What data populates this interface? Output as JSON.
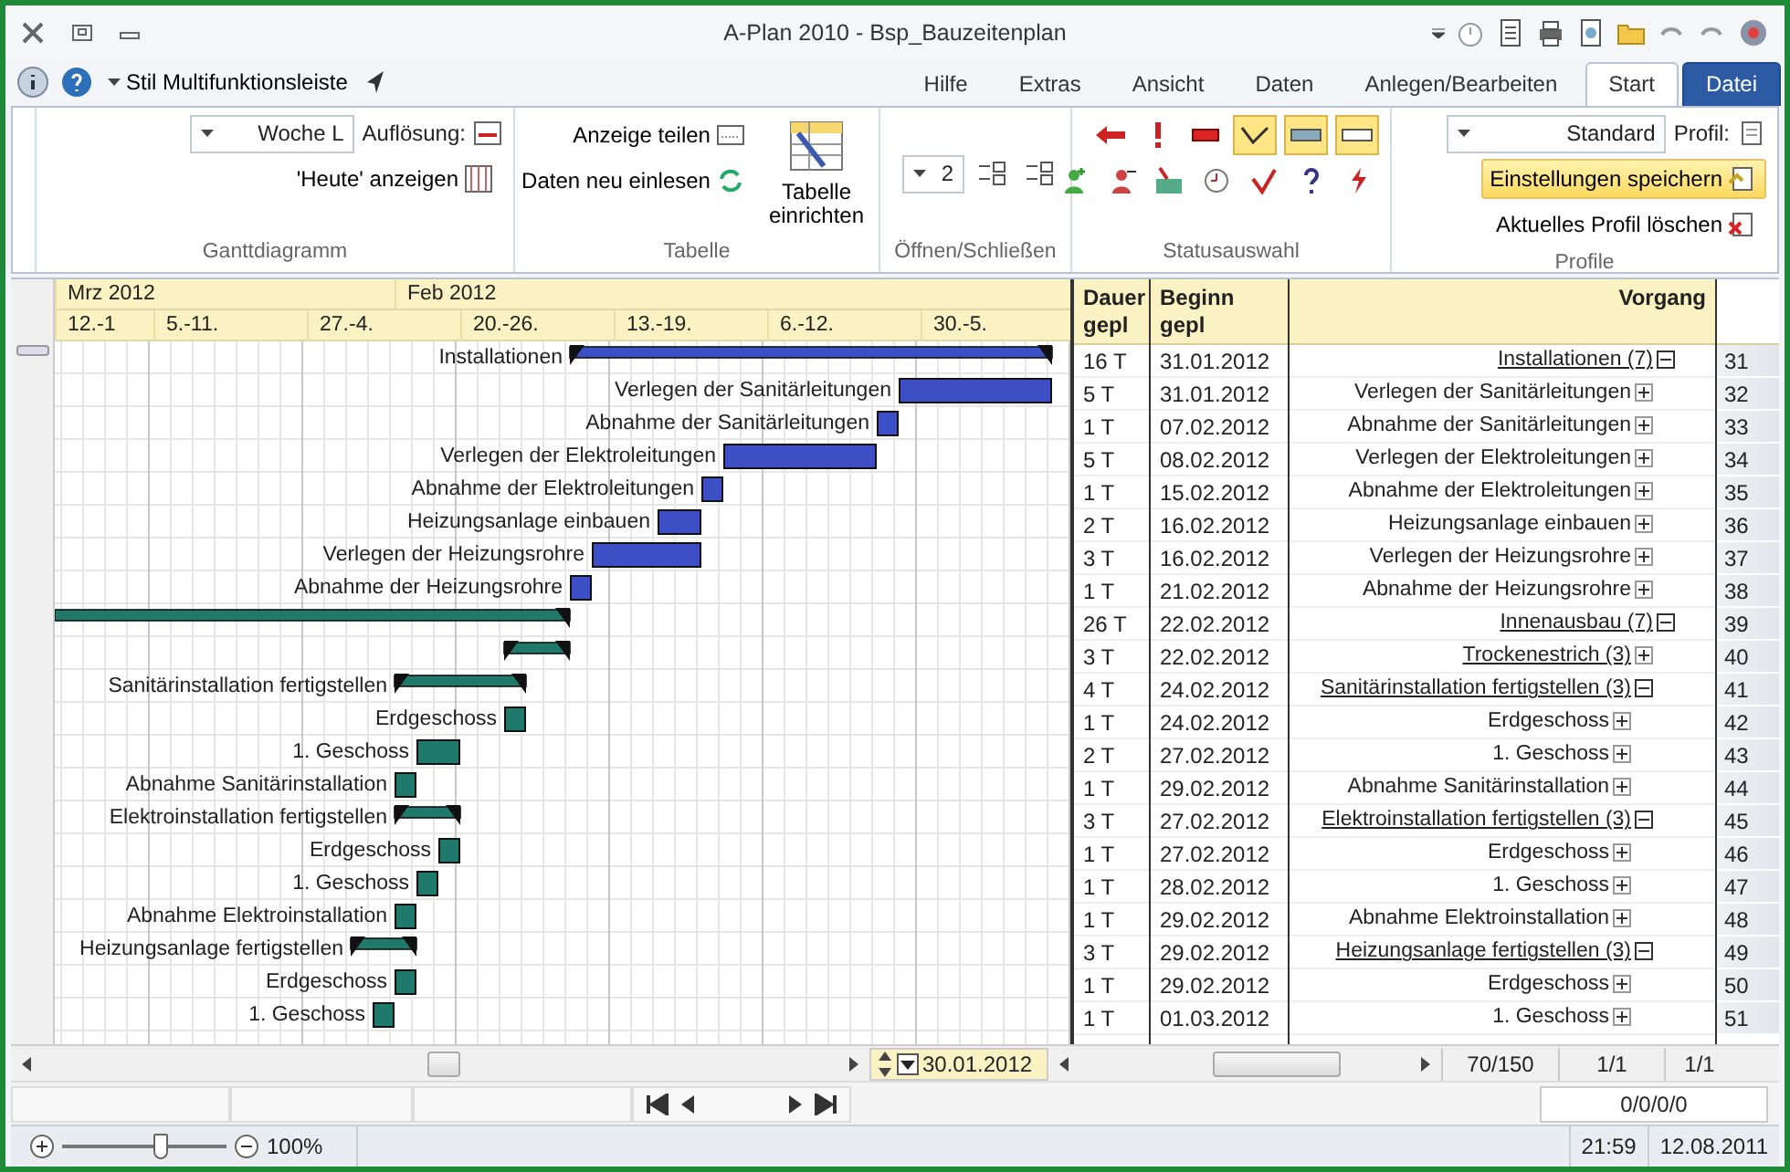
{
  "window": {
    "title": "A-Plan 2010 - Bsp_Bauzeitenplan"
  },
  "ribbon_tabs": [
    {
      "label": "Hilfe",
      "kind": "tab",
      "selected": false
    },
    {
      "label": "Extras",
      "kind": "tab",
      "selected": false
    },
    {
      "label": "Ansicht",
      "kind": "tab",
      "selected": false
    },
    {
      "label": "Daten",
      "kind": "tab",
      "selected": false
    },
    {
      "label": "Anlegen/Bearbeiten",
      "kind": "tab",
      "selected": false
    },
    {
      "label": "Start",
      "kind": "tab",
      "selected": true
    },
    {
      "label": "Datei",
      "kind": "file",
      "selected": false
    }
  ],
  "style_menu": {
    "label": "Stil Multifunktionsleiste"
  },
  "ribbon": {
    "profile": {
      "group": "Profile",
      "label": "Profil:",
      "value": "Standard",
      "buttons": [
        {
          "label": "Einstellungen speichern",
          "highlighted": true
        },
        {
          "label": "Aktuelles Profil löschen",
          "highlighted": false
        }
      ]
    },
    "status": {
      "group": "Statusauswahl",
      "toggles": [
        {
          "pressed": true
        },
        {
          "pressed": true
        },
        {
          "pressed": true
        }
      ]
    },
    "open_close": {
      "group": "Öffnen/Schließen",
      "value": "2"
    },
    "table": {
      "group": "Tabelle",
      "big_button": "Tabelle einrichten",
      "buttons": [
        "Anzeige teilen",
        "Daten neu einlesen"
      ]
    },
    "gantt": {
      "group": "Ganttdiagramm",
      "resolution_label": "Auflösung:",
      "resolution": "Woche L",
      "today_button": "'Heute' anzeigen"
    }
  },
  "timeline": {
    "months": [
      "Mrz 2012",
      "Feb 2012"
    ],
    "weeks": [
      "12.-1",
      "5.-11.",
      "27.-4.",
      "20.-26.",
      "13.-19.",
      "6.-12.",
      "30.-5."
    ]
  },
  "table": {
    "columns": [
      "Dauer gepl",
      "Beginn gepl",
      "Vorgang"
    ],
    "rows": [
      {
        "nr": "31",
        "name": "Installationen (7)",
        "begin": "31.01.2012",
        "duration": "16 T",
        "expanded": true,
        "color": "#3c4fc4",
        "bar_label": "Installationen",
        "children": [
          {
            "nr": "32",
            "name": "Verlegen der Sanitärleitungen",
            "begin": "31.01.2012",
            "duration": "5 T",
            "expanded": false,
            "color": "#3c4fc4",
            "bar_label": "Verlegen der Sanitärleitungen"
          },
          {
            "nr": "33",
            "name": "Abnahme der Sanitärleitungen",
            "begin": "07.02.2012",
            "duration": "1 T",
            "expanded": false,
            "color": "#3c4fc4",
            "bar_label": "Abnahme der Sanitärleitungen"
          },
          {
            "nr": "34",
            "name": "Verlegen der Elektroleitungen",
            "begin": "08.02.2012",
            "duration": "5 T",
            "expanded": false,
            "color": "#3c4fc4",
            "bar_label": "Verlegen der Elektroleitungen"
          },
          {
            "nr": "35",
            "name": "Abnahme der Elektroleitungen",
            "begin": "15.02.2012",
            "duration": "1 T",
            "expanded": false,
            "color": "#3c4fc4",
            "bar_label": "Abnahme der Elektroleitungen"
          },
          {
            "nr": "36",
            "name": "Heizungsanlage einbauen",
            "begin": "16.02.2012",
            "duration": "2 T",
            "expanded": false,
            "color": "#3c4fc4",
            "bar_label": "Heizungsanlage einbauen"
          },
          {
            "nr": "37",
            "name": "Verlegen der Heizungsrohre",
            "begin": "16.02.2012",
            "duration": "3 T",
            "expanded": false,
            "color": "#3c4fc4",
            "bar_label": "Verlegen der Heizungsrohre"
          },
          {
            "nr": "38",
            "name": "Abnahme der Heizungsrohre",
            "begin": "21.02.2012",
            "duration": "1 T",
            "expanded": false,
            "color": "#3c4fc4",
            "bar_label": "Abnahme der Heizungsrohre"
          }
        ]
      },
      {
        "nr": "39",
        "name": "Innenausbau (7)",
        "begin": "22.02.2012",
        "duration": "26 T",
        "expanded": true,
        "color": "#1f7a6c",
        "children": [
          {
            "nr": "40",
            "name": "Trockenestrich (3)",
            "begin": "22.02.2012",
            "duration": "3 T",
            "expanded": false,
            "summary": true,
            "color": "#1f7a6c"
          },
          {
            "nr": "41",
            "name": "Sanitärinstallation fertigstellen (3)",
            "begin": "24.02.2012",
            "duration": "4 T",
            "expanded": true,
            "color": "#1f7a6c",
            "bar_label": "Sanitärinstallation fertigstellen",
            "children": [
              {
                "nr": "42",
                "name": "Erdgeschoss",
                "begin": "24.02.2012",
                "duration": "1 T",
                "expanded": false,
                "color": "#1f7a6c",
                "bar_label": "Erdgeschoss"
              },
              {
                "nr": "43",
                "name": "1. Geschoss",
                "begin": "27.02.2012",
                "duration": "2 T",
                "expanded": false,
                "color": "#1f7a6c",
                "bar_label": "1. Geschoss"
              },
              {
                "nr": "44",
                "name": "Abnahme Sanitärinstallation",
                "begin": "29.02.2012",
                "duration": "1 T",
                "expanded": false,
                "color": "#1f7a6c",
                "bar_label": "Abnahme Sanitärinstallation"
              }
            ]
          },
          {
            "nr": "45",
            "name": "Elektroinstallation fertigstellen (3)",
            "begin": "27.02.2012",
            "duration": "3 T",
            "expanded": true,
            "color": "#1f7a6c",
            "bar_label": "Elektroinstallation fertigstellen",
            "children": [
              {
                "nr": "46",
                "name": "Erdgeschoss",
                "begin": "27.02.2012",
                "duration": "1 T",
                "expanded": false,
                "color": "#1f7a6c",
                "bar_label": "Erdgeschoss"
              },
              {
                "nr": "47",
                "name": "1. Geschoss",
                "begin": "28.02.2012",
                "duration": "1 T",
                "expanded": false,
                "color": "#1f7a6c",
                "bar_label": "1. Geschoss"
              },
              {
                "nr": "48",
                "name": "Abnahme Elektroinstallation",
                "begin": "29.02.2012",
                "duration": "1 T",
                "expanded": false,
                "color": "#1f7a6c",
                "bar_label": "Abnahme Elektroinstallation"
              }
            ]
          },
          {
            "nr": "49",
            "name": "Heizungsanlage fertigstellen (3)",
            "begin": "29.02.2012",
            "duration": "3 T",
            "expanded": true,
            "color": "#1f7a6c",
            "bar_label": "Heizungsanlage fertigstellen",
            "children": [
              {
                "nr": "50",
                "name": "Erdgeschoss",
                "begin": "29.02.2012",
                "duration": "1 T",
                "expanded": false,
                "color": "#1f7a6c",
                "bar_label": "Erdgeschoss"
              },
              {
                "nr": "51",
                "name": "1. Geschoss",
                "begin": "01.03.2012",
                "duration": "1 T",
                "expanded": false,
                "color": "#1f7a6c",
                "bar_label": "1. Geschoss"
              }
            ]
          }
        ]
      }
    ]
  },
  "navigation": {
    "date": "30.01.2012",
    "counters": [
      "70/150",
      "1/1",
      "1/1"
    ],
    "filter": "0/0/0/0"
  },
  "status_bar": {
    "zoom_slider": {
      "level": 0.6
    },
    "zoom": "100%",
    "time": "21:59",
    "date": "12.08.2011"
  }
}
